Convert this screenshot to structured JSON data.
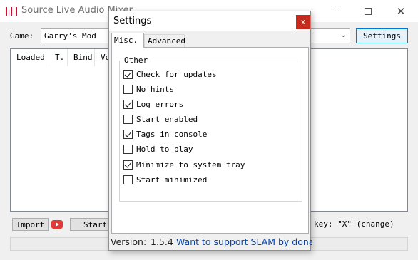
{
  "main": {
    "title": "Source Live Audio Mixer",
    "game_label": "Game:",
    "game_value": "Garry's Mod",
    "settings_button": "Settings",
    "columns": [
      "Loaded",
      "T.",
      "Bind",
      "Volume"
    ],
    "import_button": "Import",
    "start_button": "Start",
    "relay_key_text": "key: \"X\" (change)"
  },
  "settings": {
    "title": "Settings",
    "close_label": "x",
    "tabs": [
      "Misc.",
      "Advanced"
    ],
    "group_label": "Other",
    "options": [
      {
        "label": "Check for updates",
        "checked": true
      },
      {
        "label": "No hints",
        "checked": false
      },
      {
        "label": "Log errors",
        "checked": true
      },
      {
        "label": "Start enabled",
        "checked": false
      },
      {
        "label": "Tags in console",
        "checked": true
      },
      {
        "label": "Hold to play",
        "checked": false
      },
      {
        "label": "Minimize to system tray",
        "checked": true
      },
      {
        "label": "Start minimized",
        "checked": false
      }
    ],
    "version_label": "Version:",
    "version_value": "1.5.4",
    "donate_link": "Want to support SLAM by donating?"
  },
  "colors": {
    "accent": "#0078d7",
    "close_red": "#c42b1c",
    "link": "#0645ad",
    "youtube_red": "#e53935",
    "app_icon_red": "#c8102e"
  },
  "icons": [
    "app-logo-icon",
    "minimize-icon",
    "maximize-icon",
    "close-icon",
    "chevron-down-icon",
    "youtube-icon",
    "checkmark-icon"
  ]
}
